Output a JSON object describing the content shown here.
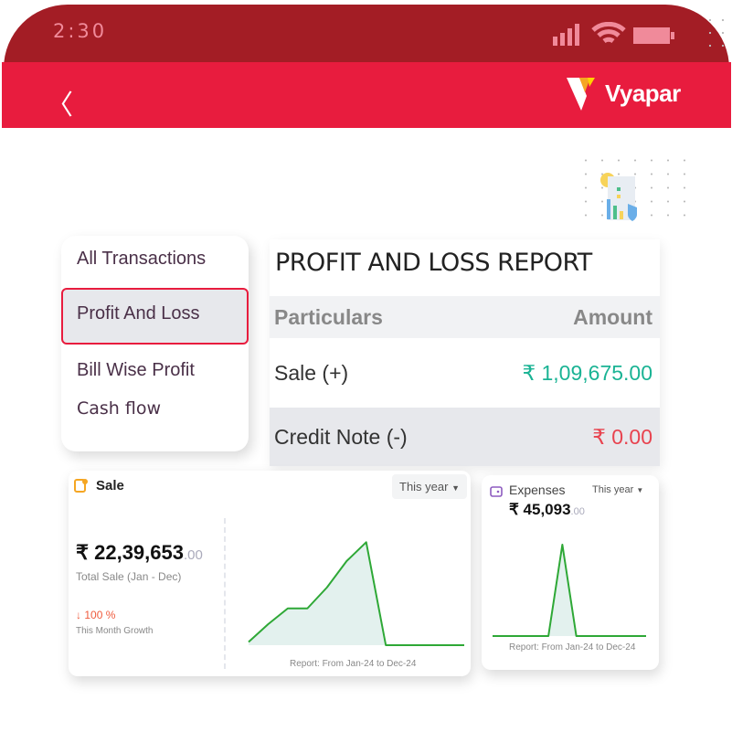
{
  "status_bar": {
    "time": "2:30"
  },
  "header": {
    "back_icon": "chevron-left-icon",
    "brand": "Vyapar"
  },
  "menu": {
    "items": [
      {
        "label": "All Transactions"
      },
      {
        "label": "Profit And Loss",
        "selected": true
      },
      {
        "label": "Bill Wise Profit"
      },
      {
        "label": "Cash flow"
      }
    ]
  },
  "report": {
    "title": "PROFIT AND LOSS REPORT",
    "columns": [
      "Particulars",
      "Amount"
    ],
    "rows": [
      {
        "label": "Sale (+)",
        "amount": "₹ 1,09,675.00",
        "color": "#1ab394"
      },
      {
        "label": "Credit Note (-)",
        "amount": "₹ 0.00",
        "color": "#e8434f"
      }
    ]
  },
  "sale_card": {
    "title": "Sale",
    "period": "This year",
    "amount": "₹ 22,39,653",
    "decimals": ".00",
    "subtitle": "Total Sale (Jan - Dec)",
    "growth": "100 %",
    "growth_label": "This Month Growth",
    "report_range": "Report: From Jan-24 to Dec-24",
    "chart_relative_values": [
      0.03,
      0.2,
      0.35,
      0.35,
      0.55,
      0.8,
      0.98,
      0.0,
      0.0,
      0.0,
      0.0,
      0.0
    ]
  },
  "expenses_card": {
    "title": "Expenses",
    "period": "This year",
    "amount": "₹ 45,093",
    "decimals": ".00",
    "report_range": "Report: From Jan-24 to Dec-24",
    "chart_relative_values": [
      0,
      0,
      0,
      0,
      0,
      1,
      0,
      0,
      0,
      0,
      0,
      0
    ]
  },
  "colors": {
    "status": "#a31d25",
    "header": "#e81c3e",
    "line": "#2ea836",
    "down": "#ef5a3c"
  }
}
